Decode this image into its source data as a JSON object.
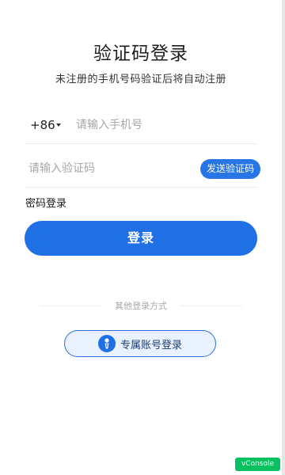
{
  "header": {
    "title": "验证码登录",
    "subtitle": "未注册的手机号码验证后将自动注册"
  },
  "phone": {
    "country_code": "+86",
    "placeholder": "请输入手机号"
  },
  "code": {
    "placeholder": "请输入验证码",
    "send_label": "发送验证码"
  },
  "links": {
    "password_login": "密码登录"
  },
  "actions": {
    "login_label": "登录"
  },
  "other": {
    "label": "其他登录方式",
    "exclusive_label": "专属账号登录",
    "exclusive_icon": "person-tie-icon"
  },
  "debug": {
    "vconsole_label": "vConsole"
  },
  "colors": {
    "primary": "#1f6fe5",
    "vconsole": "#07c160"
  }
}
